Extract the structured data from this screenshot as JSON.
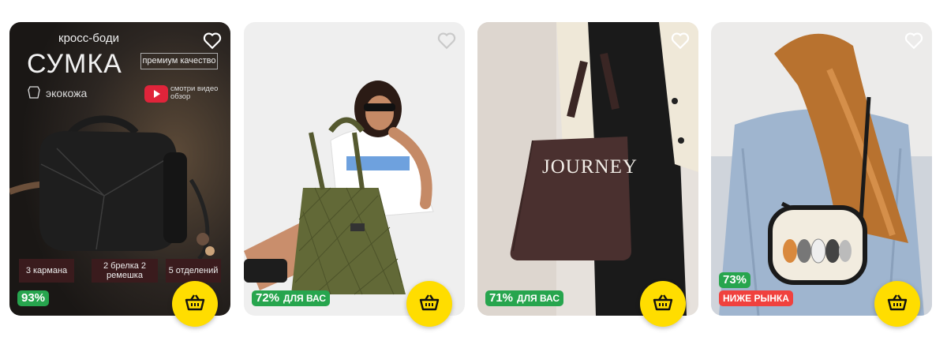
{
  "cards": [
    {
      "overlay": {
        "subtitle": "кросс-боди",
        "title": "СУМКА",
        "premium": "премиум качество",
        "material": "экокожа",
        "video": "смотри видео обзор",
        "features": [
          "3 кармана",
          "2 брелка 2 ремешка",
          "5 отделений"
        ]
      },
      "discount": "93%"
    },
    {
      "discount": "72%",
      "tag": "ДЛЯ ВАС"
    },
    {
      "overlay": {
        "brand": "JOURNEY"
      },
      "discount": "71%",
      "tag": "ДЛЯ ВАС"
    },
    {
      "discount": "73%",
      "tag": "НИЖЕ РЫНКА"
    }
  ],
  "colors": {
    "cart_button": "#FFDD00",
    "discount_green": "#27a54e",
    "below_market_red": "#f0413e"
  },
  "icons": [
    "heart-icon",
    "basket-icon",
    "play-icon",
    "leather-icon"
  ]
}
